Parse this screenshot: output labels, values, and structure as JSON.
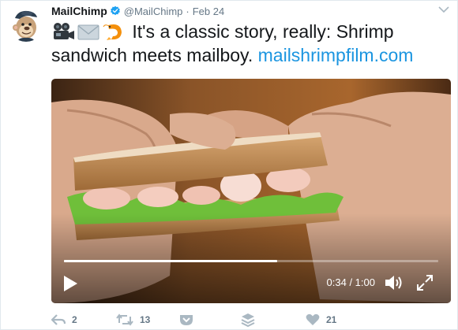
{
  "tweet": {
    "author_name": "MailChimp",
    "handle": "@MailChimp",
    "separator": "·",
    "date": "Feb 24",
    "text_main": "It's a classic story, really: Shrimp sandwich meets mailboy.",
    "link_text": "mailshrimpfilm.com",
    "emojis": [
      "movie-camera-icon",
      "envelope-icon",
      "shrimp-icon"
    ]
  },
  "video": {
    "time_display": "0:34 / 1:00",
    "progress": 0.57
  },
  "actions": {
    "reply_count": "2",
    "retweet_count": "13",
    "like_count": "21"
  },
  "colors": {
    "link": "#1b95e0",
    "muted": "#657786",
    "verified": "#1da1f2"
  }
}
